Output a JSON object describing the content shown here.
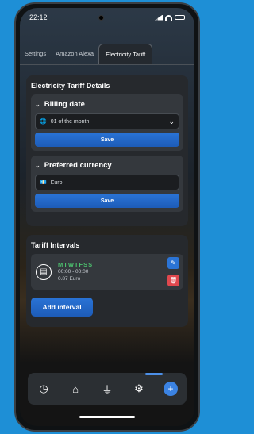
{
  "status": {
    "time": "22:12"
  },
  "tabs": [
    "Settings",
    "Amazon Alexa",
    "Electricity Tariff"
  ],
  "details": {
    "title": "Electricity Tariff Details",
    "billing": {
      "label": "Billing date",
      "value": "01 of the month",
      "save": "Save"
    },
    "currency": {
      "label": "Preferred currency",
      "value": "Euro",
      "save": "Save"
    }
  },
  "intervals": {
    "title": "Tariff Intervals",
    "item": {
      "days": "MTWTFSS",
      "time": "00:00 - 00:00",
      "price": "0.87 Euro"
    },
    "add": "Add interval"
  },
  "colors": {
    "accent": "#2a74d6",
    "green": "#4cc06e",
    "danger": "#e0484e"
  }
}
